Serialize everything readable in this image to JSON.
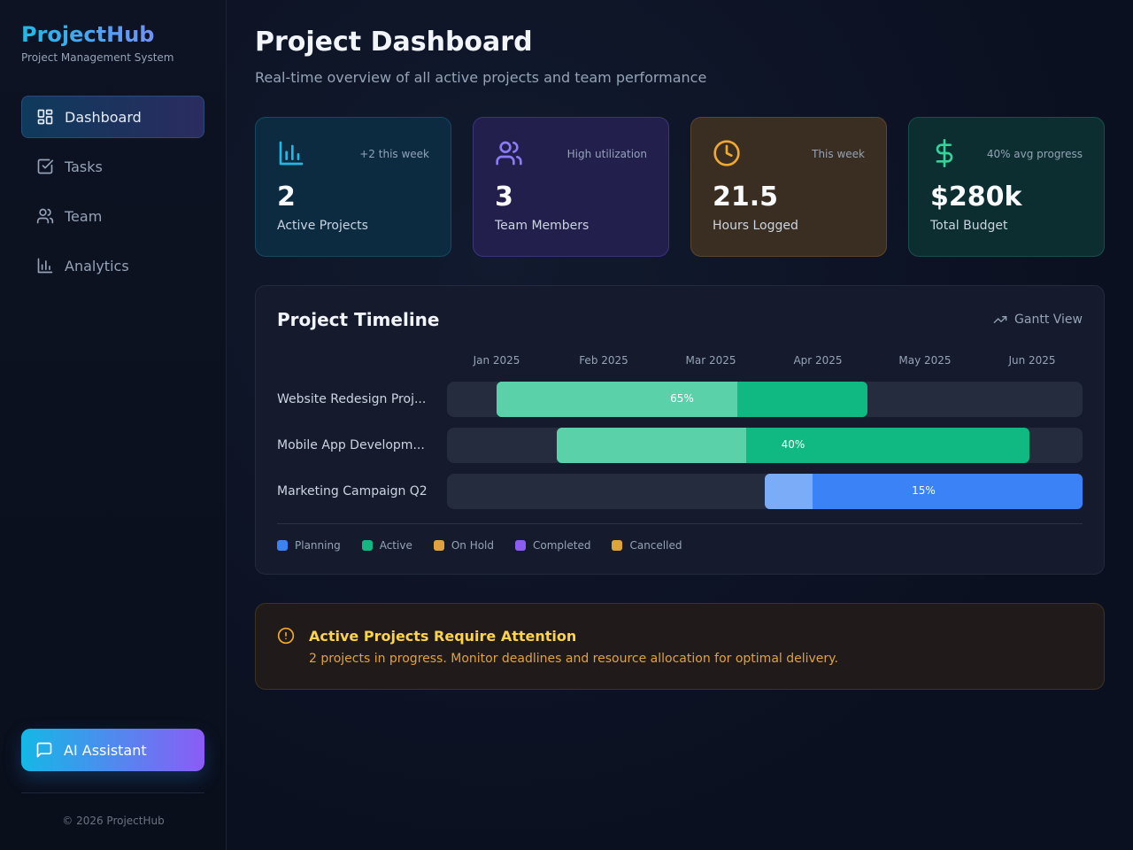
{
  "brand": {
    "title": "ProjectHub",
    "subtitle": "Project Management System"
  },
  "nav": {
    "items": [
      {
        "label": "Dashboard",
        "icon": "grid-icon",
        "active": true
      },
      {
        "label": "Tasks",
        "icon": "checkbox-icon"
      },
      {
        "label": "Team",
        "icon": "users-icon"
      },
      {
        "label": "Analytics",
        "icon": "bar-chart-icon"
      }
    ]
  },
  "ai_button": {
    "label": "AI Assistant",
    "icon": "chat-icon"
  },
  "footer": {
    "copyright": "© 2026 ProjectHub"
  },
  "header": {
    "title": "Project Dashboard",
    "subtitle": "Real-time overview of all active projects and team performance"
  },
  "stats": [
    {
      "value": "2",
      "label": "Active Projects",
      "note": "+2 this week",
      "icon": "bar-chart-icon",
      "color": "#22b8e6"
    },
    {
      "value": "3",
      "label": "Team Members",
      "note": "High utilization",
      "icon": "users-icon",
      "color": "#8b7cf6"
    },
    {
      "value": "21.5",
      "label": "Hours Logged",
      "note": "This week",
      "icon": "clock-icon",
      "color": "#f0a830"
    },
    {
      "value": "$280k",
      "label": "Total Budget",
      "note": "40% avg progress",
      "icon": "dollar-icon",
      "color": "#34d399"
    }
  ],
  "timeline": {
    "title": "Project Timeline",
    "view_label": "Gantt View",
    "months": [
      "Jan 2025",
      "Feb 2025",
      "Mar 2025",
      "Apr 2025",
      "May 2025",
      "Jun 2025"
    ],
    "projects": [
      {
        "name": "Website Redesign Proj...",
        "start": 0.078,
        "end": 0.662,
        "progress": 0.65,
        "progress_label": "65%",
        "color": "#10b981",
        "light": "#5ad1a8"
      },
      {
        "name": "Mobile App Developm...",
        "start": 0.173,
        "end": 0.917,
        "progress": 0.4,
        "progress_label": "40%",
        "color": "#10b981",
        "light": "#5ad1a8"
      },
      {
        "name": "Marketing Campaign Q2",
        "start": 0.5,
        "end": 1.0,
        "progress": 0.15,
        "progress_label": "15%",
        "color": "#3b82f6",
        "light": "#7aacf8"
      }
    ],
    "legend": [
      {
        "label": "Planning",
        "color": "#3b82f6"
      },
      {
        "label": "Active",
        "color": "#10b981"
      },
      {
        "label": "On Hold",
        "color": "#e0a33a"
      },
      {
        "label": "Completed",
        "color": "#8b5cf6"
      },
      {
        "label": "Cancelled",
        "color": "#e0a33a"
      }
    ]
  },
  "alert": {
    "title": "Active Projects Require Attention",
    "text": "2 projects in progress. Monitor deadlines and resource allocation for optimal delivery.",
    "icon": "alert-circle-icon"
  }
}
